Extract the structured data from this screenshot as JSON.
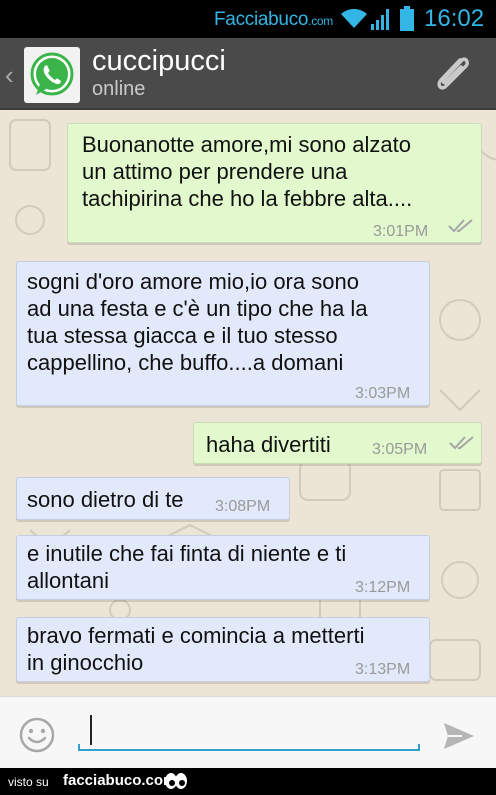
{
  "status_bar": {
    "brand": "Facciabuco",
    "brand_suffix": ".com",
    "time": "16:02",
    "color": "#33b5e5"
  },
  "header": {
    "contact_name": "cuccipucci",
    "contact_status": "online",
    "avatar_icon": "whatsapp-logo",
    "attach_icon": "paperclip-icon"
  },
  "messages": [
    {
      "direction": "out",
      "text_lines": [
        "Buonanotte amore,mi sono alzato",
        "un attimo per prendere una",
        "tachipirina che ho la febbre alta...."
      ],
      "time": "3:01PM",
      "ticks": "double"
    },
    {
      "direction": "in",
      "text_lines": [
        "sogni d'oro amore mio,io ora sono",
        "ad una festa e c'è un tipo che ha la",
        "tua stessa giacca e il tuo stesso",
        "cappellino, che buffo....a domani"
      ],
      "time": "3:03PM"
    },
    {
      "direction": "out",
      "text_lines": [
        "haha divertiti"
      ],
      "time": "3:05PM",
      "ticks": "double"
    },
    {
      "direction": "in",
      "text_lines": [
        "sono dietro di te"
      ],
      "time": "3:08PM"
    },
    {
      "direction": "in",
      "text_lines": [
        "e inutile che fai finta di niente e ti",
        "allontani"
      ],
      "time": "3:12PM"
    },
    {
      "direction": "in",
      "text_lines": [
        "bravo fermati e comincia a metterti",
        "in ginocchio"
      ],
      "time": "3:13PM"
    }
  ],
  "composer": {
    "value": "",
    "emoji_icon": "smiley-icon",
    "send_icon": "send-icon"
  },
  "footer": {
    "visto": "visto su",
    "site": "facciabuco.com"
  },
  "colors": {
    "outgoing_bubble": "#e1f9cc",
    "incoming_bubble": "#e1e9fa",
    "header": "#4a4a4a"
  }
}
